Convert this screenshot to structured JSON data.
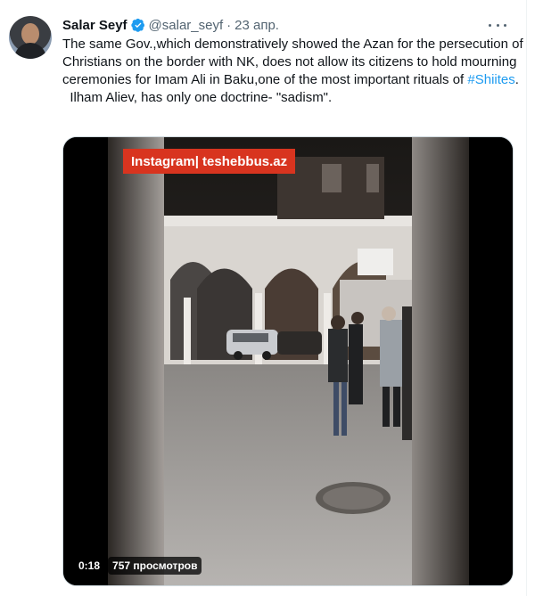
{
  "tweet": {
    "author_name": "Salar Seyf",
    "handle": "@salar_seyf",
    "separator": "·",
    "date": "23 апр.",
    "text_line1": "The same Gov.,which demonstratively showed the Azan for the persecution of Christians on the border with NK, does not allow its citizens to hold mourning ceremonies for Imam Ali in Baku,one of the most important rituals of ",
    "hashtag": "#Shiites",
    "text_line1_end": ".",
    "text_line2": "  Ilham Aliev, has only one doctrine- \"sadism\"."
  },
  "video": {
    "watermark": "Instagram| teshebbus.az",
    "duration": "0:18",
    "views": "757 просмотров"
  },
  "icons": {
    "verified": "verified-badge-icon",
    "more": "more-options-icon"
  },
  "colors": {
    "accent": "#1d9bf0",
    "text": "#0f1419",
    "muted": "#536471",
    "watermark_bg": "#d8341f"
  }
}
